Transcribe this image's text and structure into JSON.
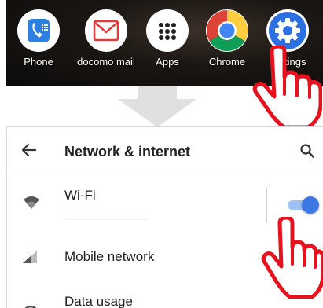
{
  "dock": {
    "apps": [
      {
        "label": "Phone",
        "icon": "phone-icon"
      },
      {
        "label": "docomo mail",
        "icon": "mail-icon"
      },
      {
        "label": "Apps",
        "icon": "apps-grid-icon"
      },
      {
        "label": "Chrome",
        "icon": "chrome-icon"
      },
      {
        "label": "Settings",
        "icon": "settings-gear-icon"
      }
    ]
  },
  "settings": {
    "title": "Network & internet",
    "rows": [
      {
        "label": "Wi-Fi",
        "icon": "wifi-icon",
        "toggle_on": true
      },
      {
        "label": "Mobile network",
        "icon": "signal-icon"
      },
      {
        "label": "Data usage",
        "icon": "data-usage-icon"
      }
    ]
  },
  "colors": {
    "accent_blue": "#3c79e6",
    "pointer_red": "#e8121e"
  }
}
